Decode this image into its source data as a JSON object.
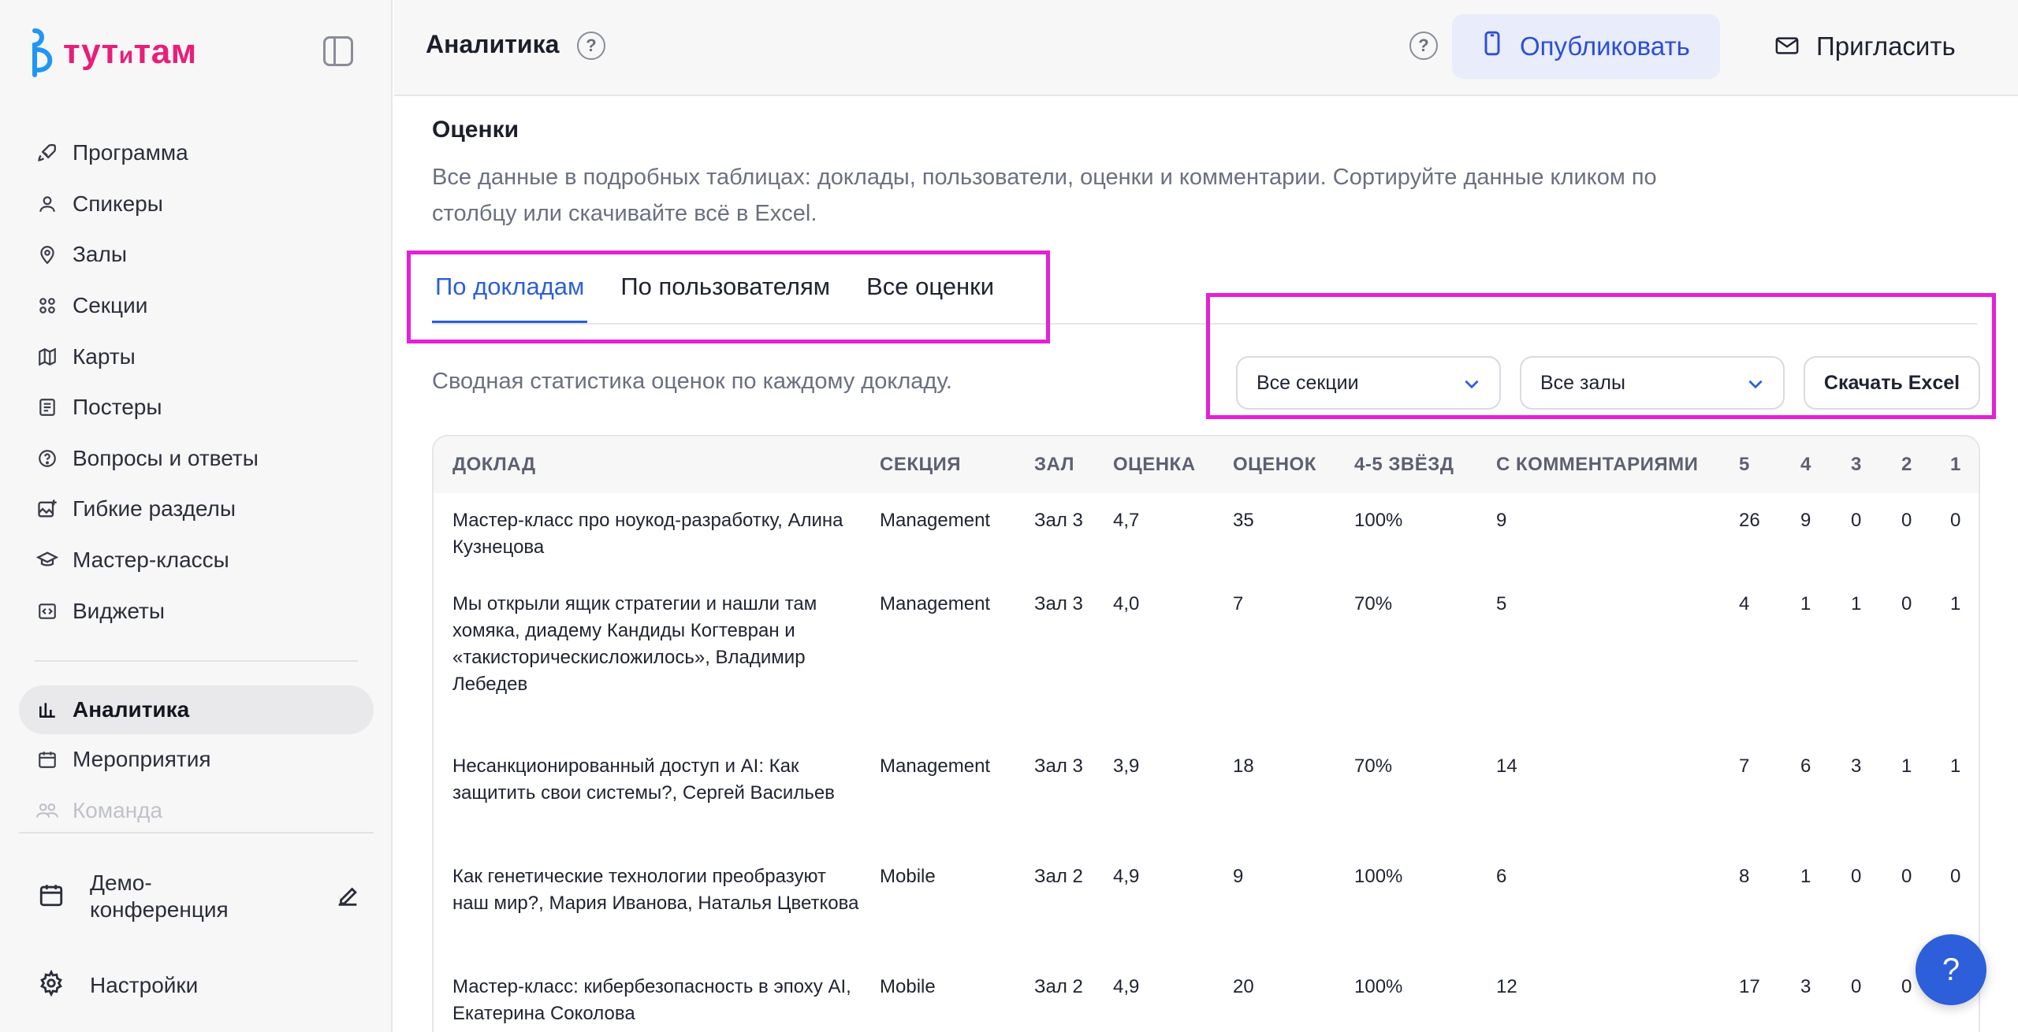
{
  "brand": {
    "name": "тут",
    "connector": "и",
    "name2": "там",
    "color": "#e91e78"
  },
  "sidebar": {
    "items": [
      {
        "label": "Программа",
        "icon": "rocket-icon"
      },
      {
        "label": "Спикеры",
        "icon": "user-icon"
      },
      {
        "label": "Залы",
        "icon": "map-pin-icon"
      },
      {
        "label": "Секции",
        "icon": "grid-icon"
      },
      {
        "label": "Карты",
        "icon": "map-icon"
      },
      {
        "label": "Постеры",
        "icon": "poster-icon"
      },
      {
        "label": "Вопросы и ответы",
        "icon": "question-circle-icon"
      },
      {
        "label": "Гибкие разделы",
        "icon": "image-plus-icon"
      },
      {
        "label": "Мастер-классы",
        "icon": "graduation-cap-icon"
      },
      {
        "label": "Виджеты",
        "icon": "code-icon"
      }
    ],
    "analytics_label": "Аналитика",
    "events_label": "Мероприятия",
    "team_label": "Команда",
    "event_name": "Демо-конференция",
    "settings_label": "Настройки"
  },
  "header": {
    "title": "Аналитика",
    "help": "?",
    "publish_label": "Опубликовать",
    "invite_label": "Пригласить"
  },
  "main": {
    "section_title": "Оценки",
    "section_desc": "Все данные в подробных таблицах: доклады, пользователи, оценки и комментарии. Сортируйте данные кликом по столбцу или скачивайте всё в Excel.",
    "tabs": [
      {
        "label": "По докладам"
      },
      {
        "label": "По пользователям"
      },
      {
        "label": "Все оценки"
      }
    ],
    "summary": "Сводная статистика оценок по каждому докладу.",
    "filters": {
      "section": "Все секции",
      "hall": "Все залы",
      "excel": "Скачать Excel"
    }
  },
  "table": {
    "columns": [
      "ДОКЛАД",
      "СЕКЦИЯ",
      "ЗАЛ",
      "ОЦЕНКА",
      "ОЦЕНОК",
      "4-5 ЗВЁЗД",
      "С КОММЕНТАРИЯМИ",
      "5",
      "4",
      "3",
      "2",
      "1"
    ],
    "rows": [
      [
        "Мастер-класс про ноукод-разработку, Алина Кузнецова",
        "Management",
        "Зал 3",
        "4,7",
        "35",
        "100%",
        "9",
        "26",
        "9",
        "0",
        "0",
        "0"
      ],
      [
        "Мы открыли ящик стратегии и нашли там хомяка, диадему Кандиды Когтевран и «такисторическисложилось», Владимир Лебедев",
        "Management",
        "Зал 3",
        "4,0",
        "7",
        "70%",
        "5",
        "4",
        "1",
        "1",
        "0",
        "1"
      ],
      [
        "Несанкционированный доступ и AI: Как защитить свои системы?, Сергей Васильев",
        "Management",
        "Зал 3",
        "3,9",
        "18",
        "70%",
        "14",
        "7",
        "6",
        "3",
        "1",
        "1"
      ],
      [
        "Как генетические технологии преобразуют наш мир?, Мария Иванова, Наталья Цветкова",
        "Mobile",
        "Зал 2",
        "4,9",
        "9",
        "100%",
        "6",
        "8",
        "1",
        "0",
        "0",
        "0"
      ],
      [
        "Мастер-класс: кибербезопасность в эпоху AI, Екатерина Соколова",
        "Mobile",
        "Зал 2",
        "4,9",
        "20",
        "100%",
        "12",
        "17",
        "3",
        "0",
        "0",
        ""
      ]
    ]
  },
  "fab_label": "?"
}
